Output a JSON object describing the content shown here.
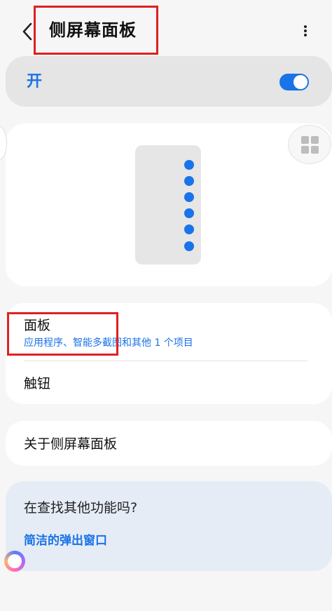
{
  "header": {
    "title": "侧屏幕面板"
  },
  "master_toggle": {
    "label": "开",
    "on": true,
    "accent": "#1a73e8"
  },
  "preview": {
    "panel_dots": 6
  },
  "list": {
    "panels": {
      "title": "面板",
      "subtitle": "应用程序、智能多截图和其他 1 个项目"
    },
    "handle": {
      "title": "触钮"
    }
  },
  "about": {
    "title": "关于侧屏幕面板"
  },
  "suggestion": {
    "title": "在查找其他功能吗?",
    "link": "简洁的弹出窗口"
  },
  "icons": {
    "back": "chevron-left-icon",
    "more": "more-vert-icon",
    "grid": "grid-icon",
    "assistant": "assistant-bubble-icon"
  },
  "colors": {
    "highlight": "#e02020",
    "accent": "#1a73e8"
  }
}
